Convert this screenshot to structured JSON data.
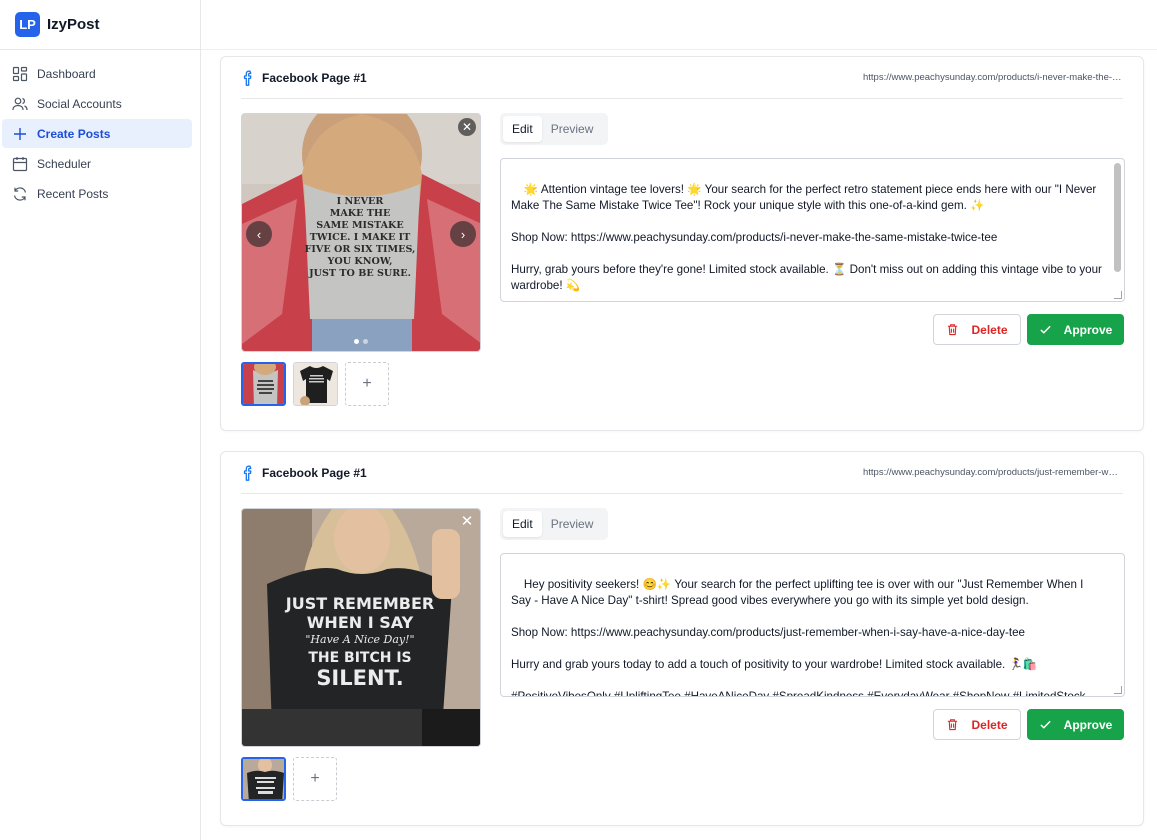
{
  "app": {
    "logo": "LP",
    "name": "IzyPost"
  },
  "nav": [
    {
      "label": "Dashboard",
      "icon": "dashboard-icon"
    },
    {
      "label": "Social Accounts",
      "icon": "users-icon"
    },
    {
      "label": "Create Posts",
      "icon": "plus-icon",
      "active": true
    },
    {
      "label": "Scheduler",
      "icon": "calendar-icon"
    },
    {
      "label": "Recent Posts",
      "icon": "refresh-icon"
    }
  ],
  "posts": [
    {
      "page": "Facebook Page #1",
      "url": "https://www.peachysunday.com/products/i-never-make-the-same-mistake-twice-tee",
      "image_text": "I NEVER MAKE THE SAME MISTAKE TWICE. I MAKE IT FIVE OR SIX TIMES, YOU KNOW, JUST TO BE SURE.",
      "tabs": [
        "Edit",
        "Preview"
      ],
      "text": "🌟 Attention vintage tee lovers! 🌟 Your search for the perfect retro statement piece ends here with our \"I Never Make The Same Mistake Twice Tee\"! Rock your unique style with this one-of-a-kind gem. ✨\n\nShop Now: https://www.peachysunday.com/products/i-never-make-the-same-mistake-twice-tee\n\nHurry, grab yours before they're gone! Limited stock available. ⏳ Don't miss out on adding this vintage vibe to your wardrobe! 💫\n\n#VintageTees #RetroFashion #UniqueStyle #StatementPiece #LimitedStock #ShopNow",
      "delete_label": "Delete",
      "approve_label": "Approve"
    },
    {
      "page": "Facebook Page #1",
      "url": "https://www.peachysunday.com/products/just-remember-when-i-say-have-a-nice-day-tee",
      "image_text": "JUST REMEMBER WHEN I SAY \"Have A Nice Day!\" THE BITCH IS SILENT.",
      "tabs": [
        "Edit",
        "Preview"
      ],
      "text": "Hey positivity seekers! 😊✨ Your search for the perfect uplifting tee is over with our \"Just Remember When I Say - Have A Nice Day\" t-shirt! Spread good vibes everywhere you go with its simple yet bold design.\n\nShop Now: https://www.peachysunday.com/products/just-remember-when-i-say-have-a-nice-day-tee\n\nHurry and grab yours today to add a touch of positivity to your wardrobe! Limited stock available. 🏃‍♀️🛍️\n\n#PositiveVibesOnly #UpliftingTee #HaveANiceDay #SpreadKindness #EverydayWear #ShopNow #LimitedStock",
      "delete_label": "Delete",
      "approve_label": "Approve"
    }
  ],
  "colors": {
    "accent": "#2563eb",
    "approve": "#16a34a",
    "delete": "#dc2626"
  }
}
